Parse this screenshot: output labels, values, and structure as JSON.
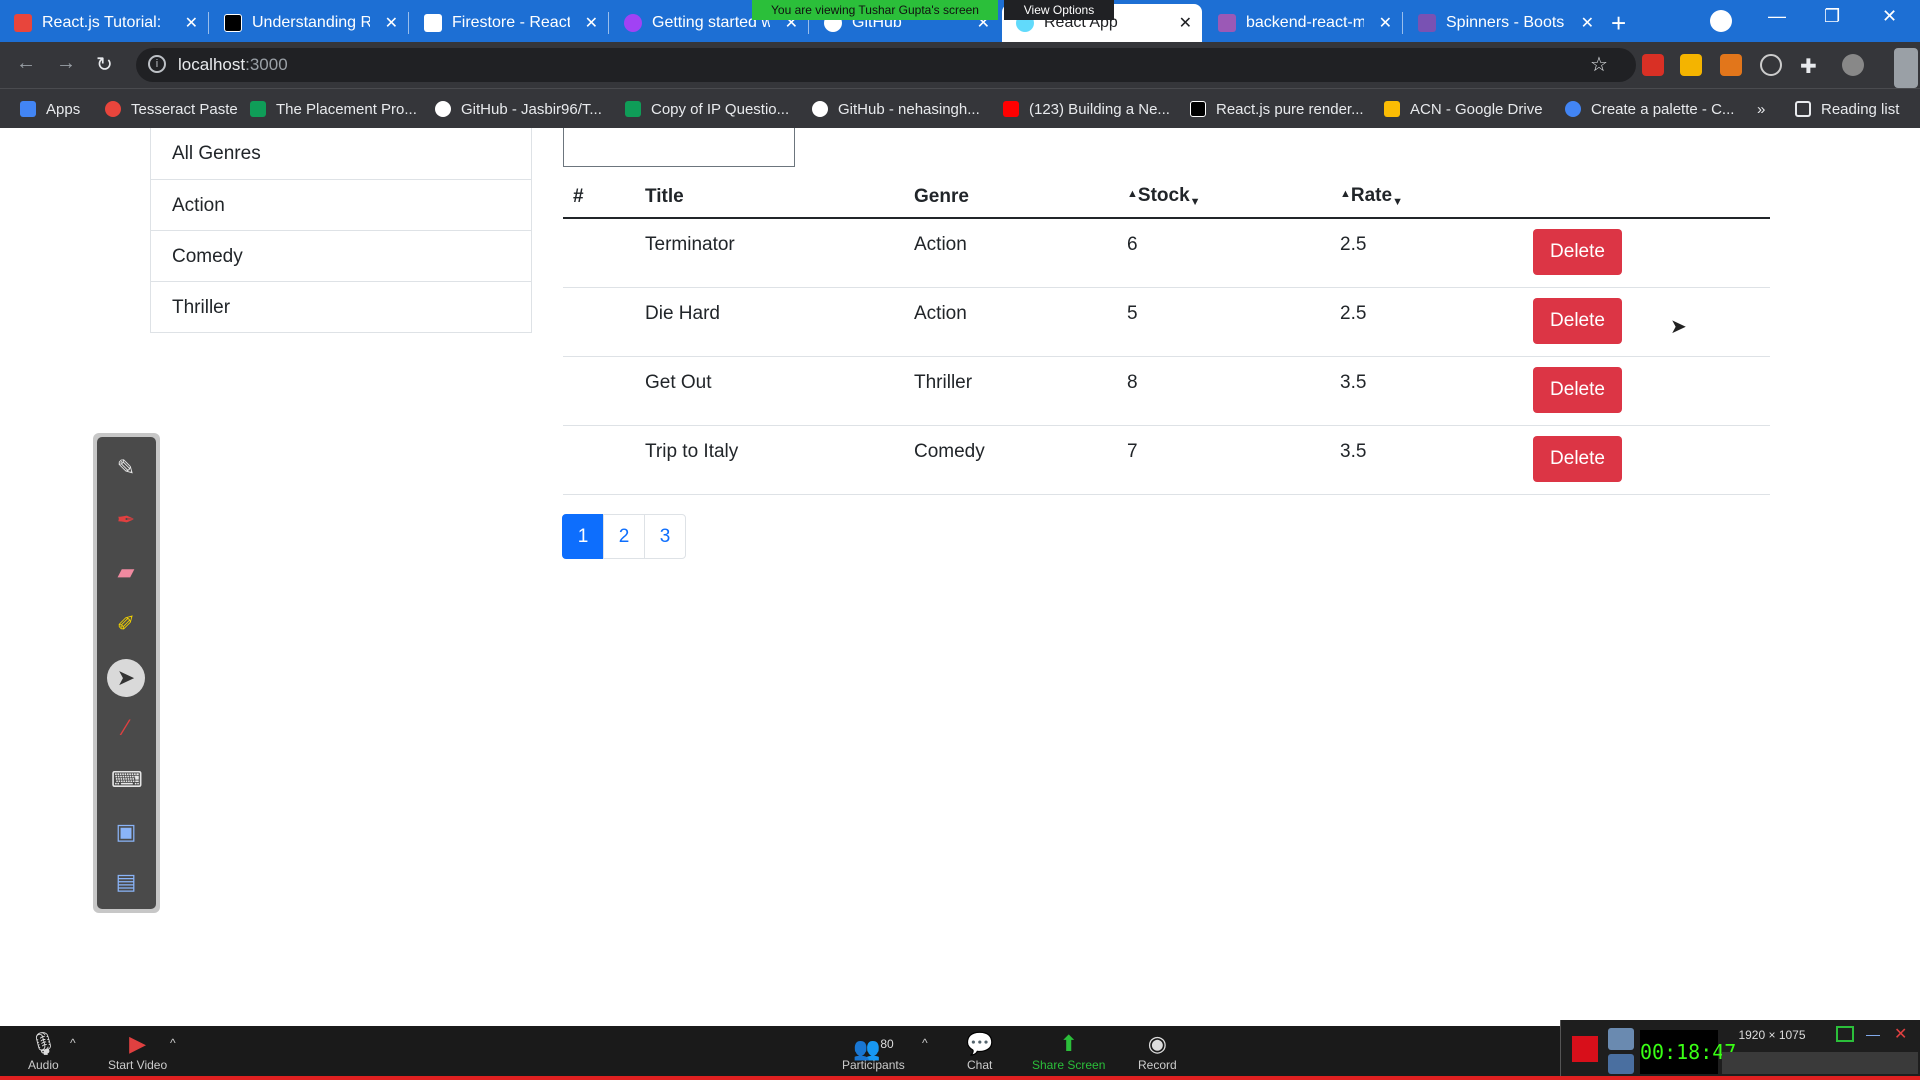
{
  "browser": {
    "tabs": [
      {
        "title": "React.js Tutorial: ",
        "icon_color": "#e8453c",
        "active": false
      },
      {
        "title": "Understanding Re",
        "icon_color": "#000000",
        "active": false
      },
      {
        "title": "Firestore - React R",
        "icon_color": "#ffffff",
        "active": false
      },
      {
        "title": "Getting started w",
        "icon_color": "#a142f4",
        "active": false
      },
      {
        "title": "GitHub",
        "icon_color": "#ffffff",
        "active": false
      },
      {
        "title": "React App",
        "icon_color": "#61dafb",
        "active": true
      },
      {
        "title": "backend-react-m",
        "icon_color": "#9b59b6",
        "active": false
      },
      {
        "title": "Spinners - Bootstr",
        "icon_color": "#7952b3",
        "active": false
      }
    ],
    "share_banner": "You are viewing Tushar Gupta's screen",
    "view_options": "View Options",
    "url_host": "localhost",
    "url_port": ":3000",
    "bookmarks": [
      "Apps",
      "Tesseract Paste",
      "The Placement Pro...",
      "GitHub - Jasbir96/T...",
      "Copy of IP Questio...",
      "GitHub - nehasingh...",
      "(123) Building a Ne...",
      "React.js pure render...",
      "ACN - Google Drive",
      "Create a palette - C..."
    ],
    "reading_list": "Reading list"
  },
  "genres": [
    "All Genres",
    "Action",
    "Comedy",
    "Thriller"
  ],
  "table": {
    "headers": {
      "num": "#",
      "title": "Title",
      "genre": "Genre",
      "stock": "Stock",
      "rate": "Rate"
    },
    "rows": [
      {
        "title": "Terminator",
        "genre": "Action",
        "stock": "6",
        "rate": "2.5"
      },
      {
        "title": "Die Hard",
        "genre": "Action",
        "stock": "5",
        "rate": "2.5"
      },
      {
        "title": "Get Out",
        "genre": "Thriller",
        "stock": "8",
        "rate": "3.5"
      },
      {
        "title": "Trip to Italy",
        "genre": "Comedy",
        "stock": "7",
        "rate": "3.5"
      }
    ],
    "delete_label": "Delete"
  },
  "pagination": {
    "pages": [
      "1",
      "2",
      "3"
    ],
    "active": "1"
  },
  "zoom": {
    "audio": "Audio",
    "start_video": "Start Video",
    "participants_count": "80",
    "participants": "Participants",
    "chat": "Chat",
    "share_screen": "Share Screen",
    "record": "Record",
    "timer": "00:18:47",
    "resolution": "1920 × 1075"
  },
  "colors": {
    "accent": "#0d6efd",
    "danger": "#dc3545",
    "share": "#2bbf3a"
  }
}
